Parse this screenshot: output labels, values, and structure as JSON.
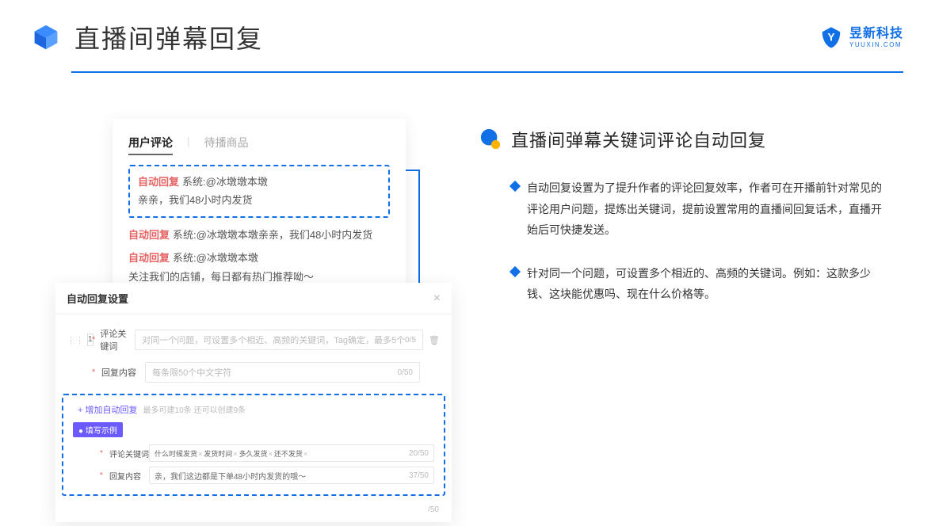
{
  "header": {
    "title": "直播间弹幕回复",
    "brand_cn": "昱新科技",
    "brand_en": "YUUXIN.COM"
  },
  "comments_panel": {
    "tab_active": "用户评论",
    "tab_inactive": "待播商品",
    "auto_tag": "自动回复",
    "sys_label": "系统:",
    "items": [
      {
        "mention": "@冰墩墩本墩",
        "msg": " 亲亲，我们48小时内发货"
      },
      {
        "mention": "@冰墩墩本墩",
        "msg": " 亲亲，我们48小时内发货"
      },
      {
        "mention": "@冰墩墩本墩",
        "msg": " 关注我们的店铺，每日都有热门推荐呦～"
      }
    ]
  },
  "settings_panel": {
    "title": "自动回复设置",
    "idx": "1",
    "fields": {
      "keyword_label": "评论关键词",
      "keyword_placeholder": "对同一个问题，可设置多个相近、高频的关键词，Tag确定，最多5个",
      "keyword_counter": "0/5",
      "reply_label": "回复内容",
      "reply_placeholder": "每条限50个中文字符",
      "reply_counter": "0/50"
    },
    "add_link": "+ 增加自动回复",
    "add_sub": "最多可建10条 还可以创建9条",
    "example_badge": "● 填写示例",
    "example": {
      "keyword_label": "评论关键词",
      "reply_label": "回复内容",
      "tags": [
        "什么时候发货",
        "发货时间",
        "多久发货",
        "还不发货"
      ],
      "kw_counter": "20/50",
      "reply_value": "亲，我们这边都是下单48小时内发货的哦～",
      "reply_counter": "37/50"
    },
    "outer_counter": "/50"
  },
  "right": {
    "heading": "直播间弹幕关键词评论自动回复",
    "bullets": [
      "自动回复设置为了提升作者的评论回复效率，作者可在开播前针对常见的评论用户问题，提炼出关键词，提前设置常用的直播间回复话术，直播开始后可快捷发送。",
      "针对同一个问题，可设置多个相近的、高频的关键词。例如：这款多少钱、这块能优惠吗、现在什么价格等。"
    ]
  }
}
